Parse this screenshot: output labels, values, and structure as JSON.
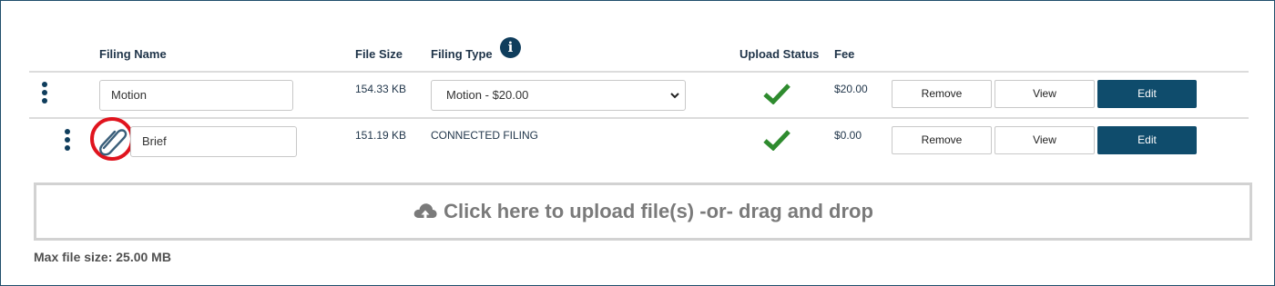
{
  "headers": {
    "filing_name": "Filing Name",
    "file_size": "File Size",
    "filing_type": "Filing Type",
    "upload_status": "Upload Status",
    "fee": "Fee"
  },
  "rows": [
    {
      "filing_name": "Motion",
      "file_size": "154.33 KB",
      "filing_type_selected": "Motion - $20.00",
      "upload_status": "success",
      "fee": "$20.00",
      "remove_label": "Remove",
      "view_label": "View",
      "edit_label": "Edit"
    },
    {
      "filing_name": "Brief",
      "file_size": "151.19 KB",
      "filing_type": "CONNECTED FILING",
      "upload_status": "success",
      "fee": "$0.00",
      "remove_label": "Remove",
      "view_label": "View",
      "edit_label": "Edit",
      "attachment_icon": "paperclip-icon",
      "attachment_highlighted": true
    }
  ],
  "upload": {
    "label": "Click here to upload file(s) -or- drag and drop",
    "icon": "cloud-upload-icon"
  },
  "max_file_size": "Max file size: 25.00 MB",
  "colors": {
    "primary": "#0f4c6c",
    "success": "#2e8b2e",
    "highlight": "#e0141e"
  }
}
